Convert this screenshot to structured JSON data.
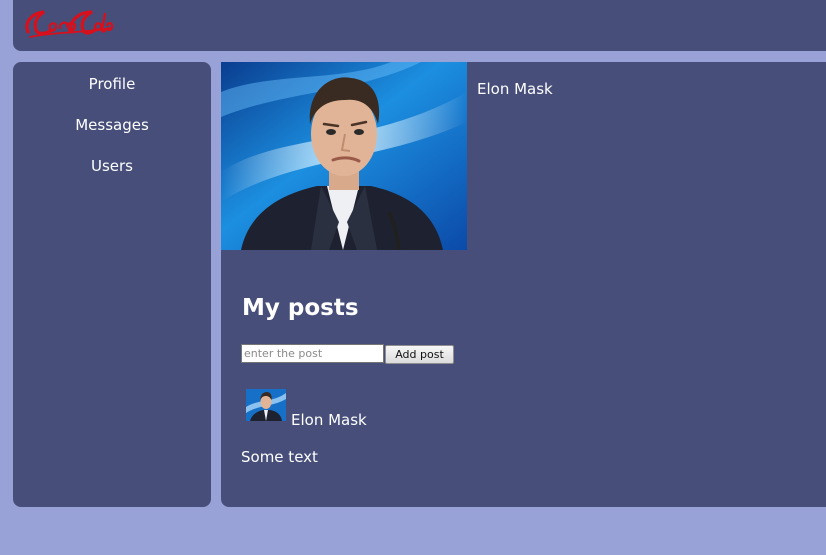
{
  "app": {
    "logo_text": "Coca-Cola"
  },
  "colors": {
    "page_background": "#98a2d6",
    "panel_background": "#464e79",
    "text": "#ffffff",
    "logo_red": "#d8101c"
  },
  "sidebar": {
    "items": [
      {
        "label": "Profile"
      },
      {
        "label": "Messages"
      },
      {
        "label": "Users"
      }
    ]
  },
  "profile": {
    "name": "Elon Mask",
    "photo_icon": "person-photo"
  },
  "posts": {
    "title": "My posts",
    "input_placeholder": "enter the post",
    "input_value": "",
    "add_button_label": "Add post",
    "items": [
      {
        "author": "Elon Mask",
        "text": "Some text",
        "avatar_icon": "person-photo"
      }
    ]
  }
}
